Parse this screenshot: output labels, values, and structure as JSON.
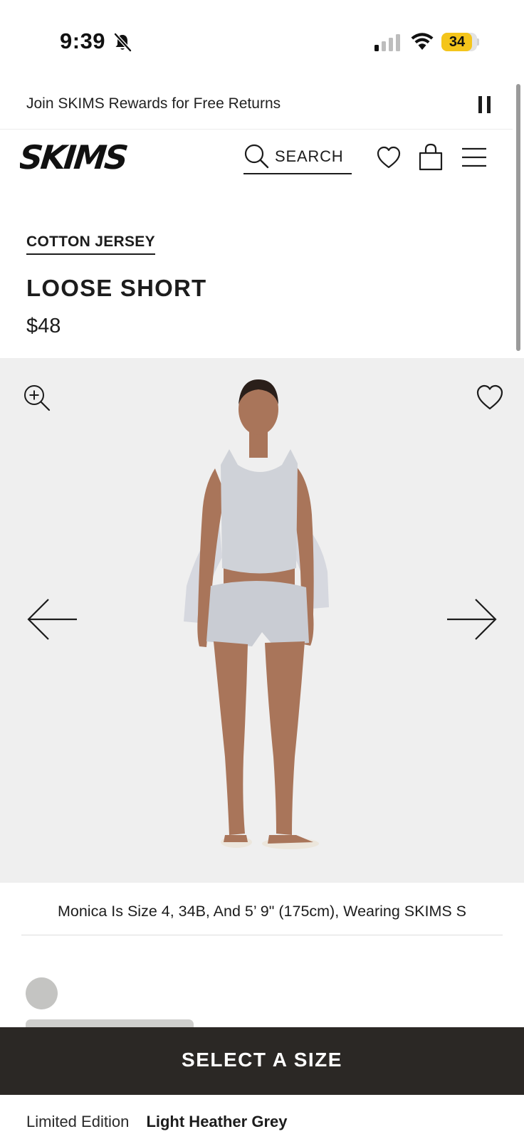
{
  "status_bar": {
    "time": "9:39",
    "battery_percent": "34",
    "battery_level": 0.34,
    "battery_color": "#f4c51b",
    "icons": [
      "bell-slash-icon",
      "cellular-signal-icon",
      "wifi-icon",
      "battery-icon"
    ]
  },
  "promo": {
    "text": "Join SKIMS Rewards for Free Returns",
    "icon": "pause-icon"
  },
  "header": {
    "logo_text": "SKIMS",
    "search_label": "SEARCH",
    "icons": [
      "search-icon",
      "heart-icon",
      "shopping-bag-icon",
      "menu-icon"
    ]
  },
  "product": {
    "category": "COTTON JERSEY",
    "name": "LOOSE SHORT",
    "price": "$48"
  },
  "gallery": {
    "icons": [
      "zoom-in-icon",
      "heart-icon",
      "arrow-left-icon",
      "arrow-right-icon"
    ],
    "background": "#efefef"
  },
  "caption": {
    "text": "Monica Is Size 4, 34B, And 5’ 9\" (175cm), Wearing SKIMS S"
  },
  "swatch": {
    "color": "#c4c4c2"
  },
  "cta": {
    "label": "SELECT A SIZE",
    "background": "#2b2825"
  },
  "edition": {
    "type": "Limited Edition",
    "color_name": "Light Heather Grey"
  }
}
